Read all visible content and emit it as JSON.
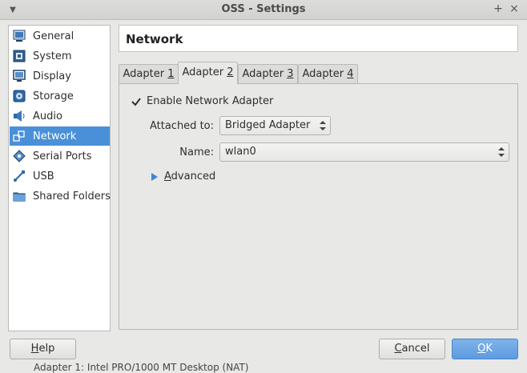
{
  "window": {
    "title": "OSS - Settings"
  },
  "sidebar": {
    "items": [
      {
        "label": "General",
        "icon": "general-icon"
      },
      {
        "label": "System",
        "icon": "system-icon"
      },
      {
        "label": "Display",
        "icon": "display-icon"
      },
      {
        "label": "Storage",
        "icon": "storage-icon"
      },
      {
        "label": "Audio",
        "icon": "audio-icon"
      },
      {
        "label": "Network",
        "icon": "network-icon",
        "selected": true
      },
      {
        "label": "Serial Ports",
        "icon": "serial-ports-icon"
      },
      {
        "label": "USB",
        "icon": "usb-icon"
      },
      {
        "label": "Shared Folders",
        "icon": "shared-folders-icon"
      }
    ]
  },
  "page": {
    "title": "Network"
  },
  "tabs": [
    {
      "label": "Adapter ",
      "mnemonic": "1"
    },
    {
      "label": "Adapter ",
      "mnemonic": "2",
      "active": true
    },
    {
      "label": "Adapter ",
      "mnemonic": "3"
    },
    {
      "label": "Adapter ",
      "mnemonic": "4"
    }
  ],
  "adapter": {
    "enable_label": "Enable Network Adapter",
    "enabled": true,
    "attached_to_label": "Attached to:",
    "attached_to_value": "Bridged Adapter",
    "name_label": "Name:",
    "name_value": "wlan0",
    "advanced_prefix": "",
    "advanced_mnemonic": "A",
    "advanced_rest": "dvanced"
  },
  "buttons": {
    "help": {
      "mnemonic": "H",
      "rest": "elp"
    },
    "cancel": {
      "mnemonic": "C",
      "rest": "ancel"
    },
    "ok": {
      "mnemonic": "O",
      "rest": "K"
    }
  },
  "behind_window_text": "Adapter 1:   Intel PRO/1000 MT Desktop (NAT)",
  "colors": {
    "accent": "#4a90d9",
    "selection_text": "#ffffff"
  }
}
